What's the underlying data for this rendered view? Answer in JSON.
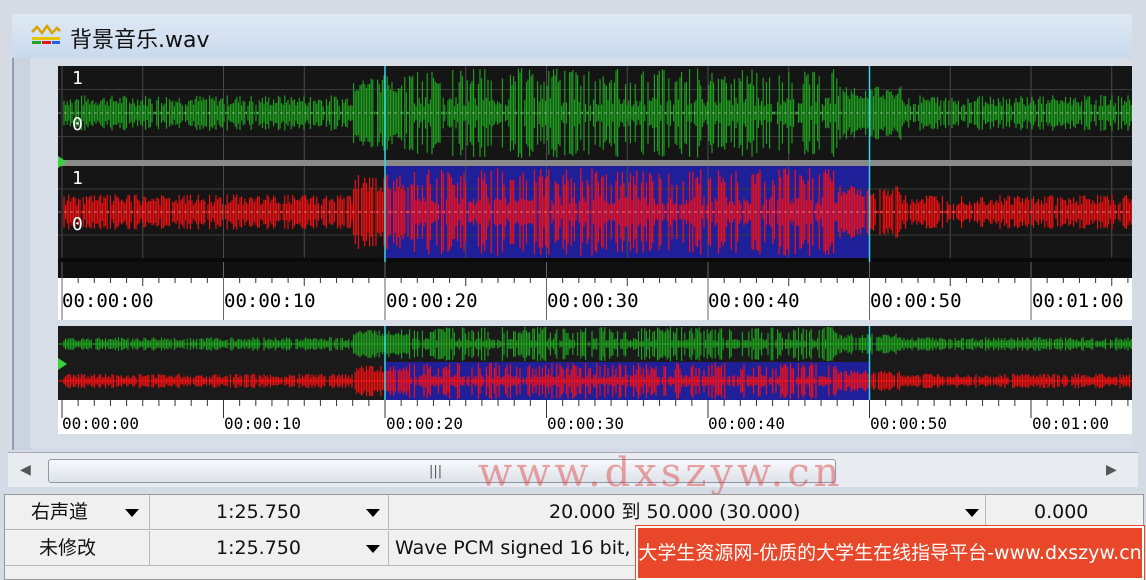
{
  "window": {
    "title": "背景音乐.wav",
    "title_icon": "waveform-icon"
  },
  "waveform": {
    "channel_top_labels": [
      "1",
      "0"
    ],
    "channel_bottom_labels": [
      "1",
      "0"
    ],
    "selection": {
      "start_seconds": 20.0,
      "end_seconds": 50.0
    },
    "colors": {
      "left_channel": "#1fa81f",
      "right_channel": "#ff1010",
      "selection_bg": "#1f1f9a",
      "background": "#0a0a0a"
    }
  },
  "timeline": {
    "labels": [
      "00:00:00",
      "00:00:10",
      "00:00:20",
      "00:00:30",
      "00:00:40",
      "00:00:50",
      "00:01:00"
    ]
  },
  "overview_timeline": {
    "labels": [
      "00:00:00",
      "00:00:10",
      "00:00:20",
      "00:00:30",
      "00:00:40",
      "00:00:50",
      "00:01:00"
    ]
  },
  "scrollbar": {
    "left_arrow": "◀",
    "right_arrow": "▶",
    "grip": "|||"
  },
  "status": {
    "row1": {
      "channel": "右声道",
      "length": "1:25.750",
      "selection": "20.000 到 50.000 (30.000)",
      "value": "0.000"
    },
    "row2": {
      "state": "未修改",
      "length": "1:25.750",
      "format": "Wave PCM signed 16 bit,"
    }
  },
  "watermark": "www.dxszyw.cn",
  "banner": "大学生资源网-优质的大学生在线指导平台-www.dxszyw.cn"
}
